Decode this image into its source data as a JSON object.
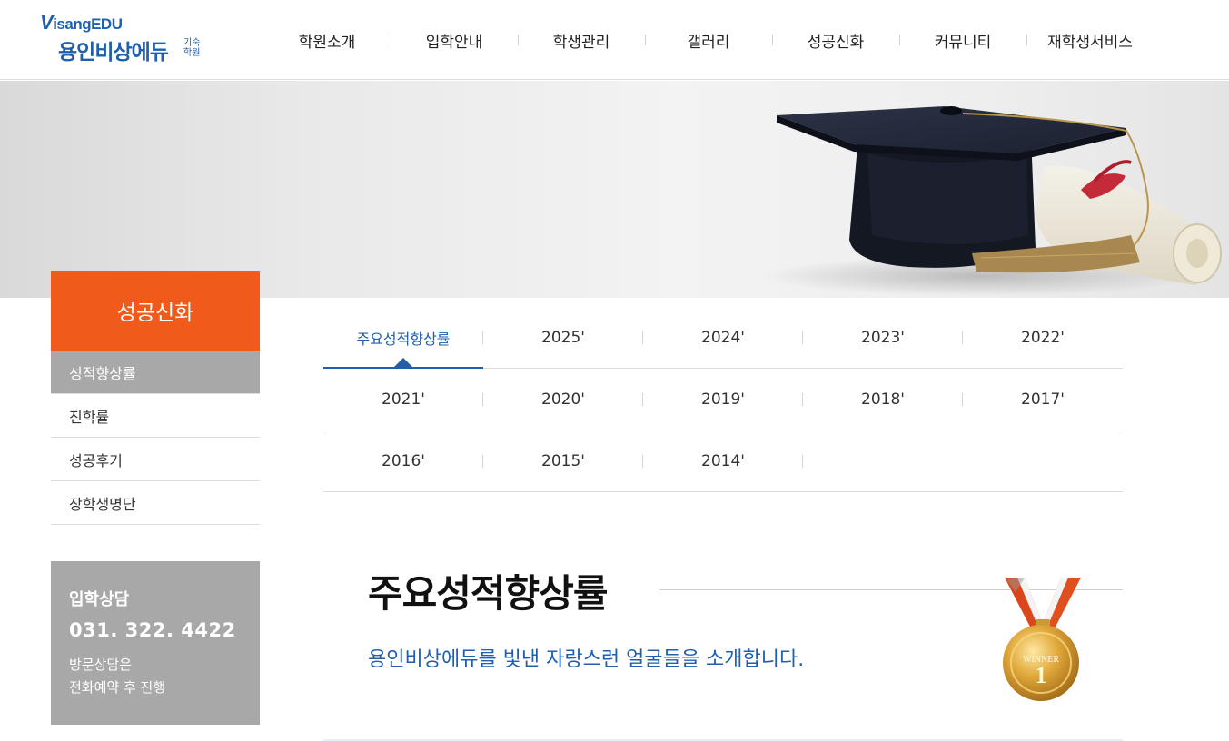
{
  "logo": {
    "brand_top": "isangEDU",
    "brand_v": "V",
    "brand_main": "용인비상에듀",
    "brand_sub": "기숙학원"
  },
  "gnb": {
    "items": [
      "학원소개",
      "입학안내",
      "학생관리",
      "갤러리",
      "성공신화",
      "커뮤니티",
      "재학생서비스"
    ]
  },
  "sidebar": {
    "title": "성공신화",
    "items": [
      {
        "label": "성적향상률",
        "active": true
      },
      {
        "label": "진학률",
        "active": false
      },
      {
        "label": "성공후기",
        "active": false
      },
      {
        "label": "장학생명단",
        "active": false
      }
    ],
    "consult": {
      "title": "입학상담",
      "phone": "031. 322. 4422",
      "note_line1": "방문상담은",
      "note_line2": "전화예약 후 진행"
    }
  },
  "tabs": {
    "rows": [
      [
        "주요성적향상률",
        "2025'",
        "2024'",
        "2023'",
        "2022'"
      ],
      [
        "2021'",
        "2020'",
        "2019'",
        "2018'",
        "2017'"
      ],
      [
        "2016'",
        "2015'",
        "2014'"
      ]
    ],
    "active": "주요성적향상률"
  },
  "content": {
    "title": "주요성적향상률",
    "subtitle": "용인비상에듀를 빛낸 자랑스런 얼굴들을 소개합니다.",
    "medal_text": "WINNER",
    "medal_number": "1"
  },
  "colors": {
    "accent_blue": "#1f5fae",
    "sidebar_orange": "#f05a1a",
    "sidebar_gray": "#a8a8a8"
  }
}
